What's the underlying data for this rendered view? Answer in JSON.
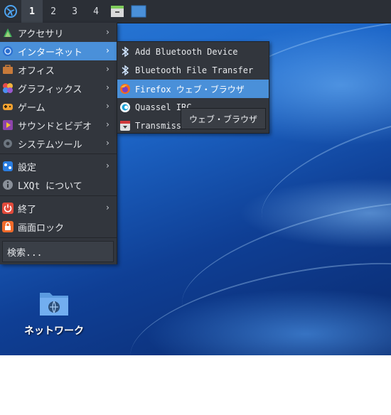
{
  "panel": {
    "desktops": [
      "1",
      "2",
      "3",
      "4"
    ],
    "active_desktop": "1"
  },
  "main_menu": {
    "items": [
      {
        "label": "アクセサリ",
        "icon": "accessories-icon",
        "has_submenu": true
      },
      {
        "label": "インターネット",
        "icon": "internet-icon",
        "has_submenu": true,
        "highlighted": true
      },
      {
        "label": "オフィス",
        "icon": "office-icon",
        "has_submenu": true
      },
      {
        "label": "グラフィックス",
        "icon": "graphics-icon",
        "has_submenu": true
      },
      {
        "label": "ゲーム",
        "icon": "games-icon",
        "has_submenu": true
      },
      {
        "label": "サウンドとビデオ",
        "icon": "multimedia-icon",
        "has_submenu": true
      },
      {
        "label": "システムツール",
        "icon": "system-tools-icon",
        "has_submenu": true
      },
      {
        "label": "設定",
        "icon": "settings-icon",
        "has_submenu": true
      },
      {
        "label": "LXQt について",
        "icon": "info-icon",
        "has_submenu": false
      },
      {
        "label": "終了",
        "icon": "power-icon",
        "has_submenu": true
      },
      {
        "label": "画面ロック",
        "icon": "lock-icon",
        "has_submenu": false
      }
    ],
    "search_placeholder": "検索..."
  },
  "sub_menu": {
    "items": [
      {
        "label": "Add Bluetooth Device",
        "icon": "bluetooth-icon"
      },
      {
        "label": "Bluetooth File Transfer",
        "icon": "bluetooth-icon"
      },
      {
        "label": "Firefox ウェブ・ブラウザ",
        "icon": "firefox-icon",
        "highlighted": true
      },
      {
        "label": "Quassel IRC",
        "icon": "quassel-icon"
      },
      {
        "label": "Transmission",
        "icon": "transmission-icon"
      }
    ]
  },
  "tooltip": {
    "text": "ウェブ・ブラウザ"
  },
  "desktop_icons": [
    {
      "label": "ネットワーク",
      "icon": "network-folder-icon"
    }
  ],
  "colors": {
    "highlight": "#4a90d9",
    "menu_bg": "#32363d",
    "panel_bg": "#2b2f36"
  }
}
